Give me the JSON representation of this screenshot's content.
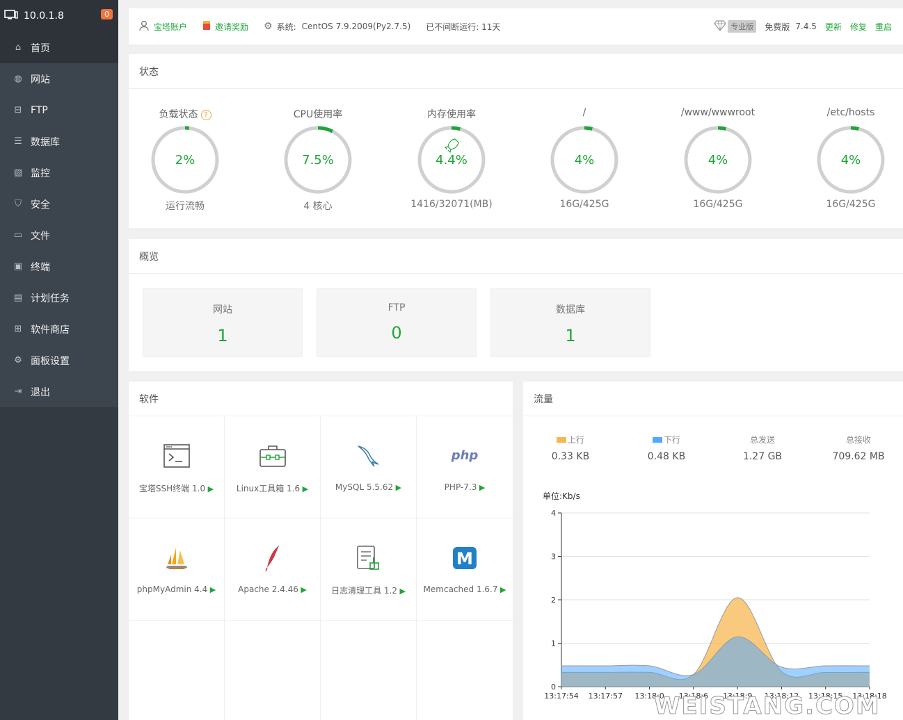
{
  "sidebar": {
    "host": "10.0.1.8",
    "badge": "0",
    "items": [
      {
        "label": "首页",
        "icon": "home-icon"
      },
      {
        "label": "网站",
        "icon": "globe-icon"
      },
      {
        "label": "FTP",
        "icon": "ftp-icon"
      },
      {
        "label": "数据库",
        "icon": "database-icon"
      },
      {
        "label": "监控",
        "icon": "monitor-chart-icon"
      },
      {
        "label": "安全",
        "icon": "shield-icon"
      },
      {
        "label": "文件",
        "icon": "folder-icon"
      },
      {
        "label": "终端",
        "icon": "terminal-icon"
      },
      {
        "label": "计划任务",
        "icon": "calendar-icon"
      },
      {
        "label": "软件商店",
        "icon": "grid-icon"
      },
      {
        "label": "面板设置",
        "icon": "gear-icon"
      },
      {
        "label": "退出",
        "icon": "logout-icon"
      }
    ]
  },
  "topbar": {
    "account": "宝塔账户",
    "invite": "邀请奖励",
    "system_label": "系统:",
    "system_value": "CentOS 7.9.2009(Py2.7.5)",
    "uptime": "已不间断运行: 11天",
    "pro": "专业版",
    "free": "免费版",
    "version": "7.4.5",
    "update": "更新",
    "repair": "修复",
    "restart": "重启"
  },
  "status": {
    "title": "状态",
    "gauges": [
      {
        "label": "负载状态",
        "value": "2%",
        "pct": 0.02,
        "sub": "运行流畅"
      },
      {
        "label": "CPU使用率",
        "value": "7.5%",
        "pct": 0.075,
        "sub": "4 核心"
      },
      {
        "label": "内存使用率",
        "value": "4.4%",
        "pct": 0.044,
        "sub": "1416/32071(MB)"
      },
      {
        "label": "/",
        "value": "4%",
        "pct": 0.04,
        "sub": "16G/425G"
      },
      {
        "label": "/www/wwwroot",
        "value": "4%",
        "pct": 0.04,
        "sub": "16G/425G"
      },
      {
        "label": "/etc/hosts",
        "value": "4%",
        "pct": 0.04,
        "sub": "16G/425G"
      }
    ]
  },
  "overview": {
    "title": "概览",
    "boxes": [
      {
        "label": "网站",
        "value": "1"
      },
      {
        "label": "FTP",
        "value": "0"
      },
      {
        "label": "数据库",
        "value": "1"
      }
    ]
  },
  "software": {
    "title": "软件",
    "items": [
      {
        "name": "宝塔SSH终端 1.0",
        "icon": "terminal-window-icon"
      },
      {
        "name": "Linux工具箱 1.6",
        "icon": "toolbox-icon"
      },
      {
        "name": "MySQL 5.5.62",
        "icon": "mysql-dolphin-icon"
      },
      {
        "name": "PHP-7.3",
        "icon": "php-icon",
        "logo_text": "php"
      },
      {
        "name": "phpMyAdmin 4.4",
        "icon": "phpmyadmin-sail-icon"
      },
      {
        "name": "Apache 2.4.46",
        "icon": "apache-feather-icon"
      },
      {
        "name": "日志清理工具 1.2",
        "icon": "log-clean-icon"
      },
      {
        "name": "Memcached 1.6.7",
        "icon": "memcached-icon",
        "logo_text": "M"
      }
    ]
  },
  "flow": {
    "title": "流量",
    "stats": [
      {
        "label": "上行",
        "value": "0.33 KB",
        "color": "#f7b851"
      },
      {
        "label": "下行",
        "value": "0.48 KB",
        "color": "#52a9ff"
      },
      {
        "label": "总发送",
        "value": "1.27 GB"
      },
      {
        "label": "总接收",
        "value": "709.62 MB"
      }
    ]
  },
  "chart_data": {
    "type": "area",
    "ylabel": "单位:Kb/s",
    "ylim": [
      0,
      4
    ],
    "yticks": [
      "0",
      "1",
      "2",
      "3",
      "4"
    ],
    "x": [
      "13:17:54",
      "13:17:57",
      "13:18:0",
      "13:18:6",
      "13:18:9",
      "13:18:12",
      "13:18:15",
      "13:18:18"
    ],
    "series": [
      {
        "name": "上行",
        "color": "#f7b851",
        "values": [
          0.33,
          0.33,
          0.33,
          0.28,
          2.05,
          0.35,
          0.33,
          0.33
        ]
      },
      {
        "name": "下行",
        "color": "#52a9ff",
        "values": [
          0.48,
          0.48,
          0.48,
          0.28,
          1.15,
          0.45,
          0.48,
          0.48
        ]
      }
    ]
  },
  "watermark": "WEISTANG.COM"
}
